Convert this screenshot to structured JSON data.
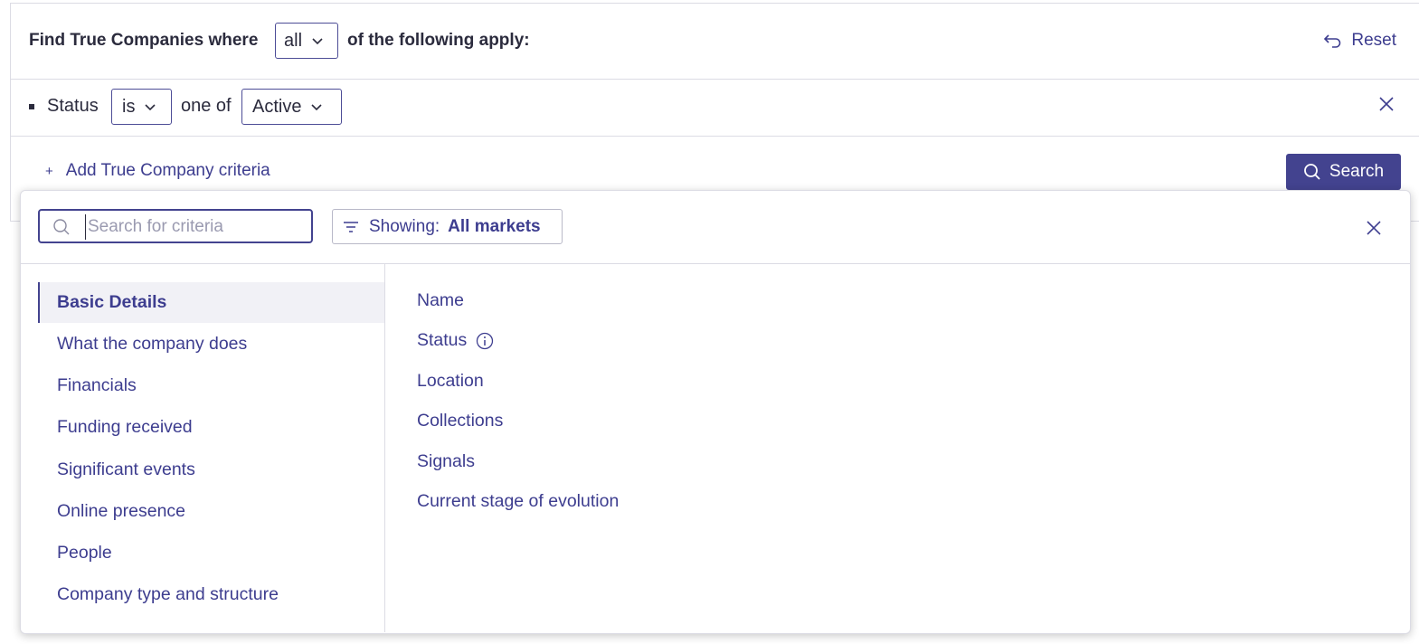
{
  "filter_bar": {
    "prefix": "Find True Companies where",
    "match_mode": "all",
    "suffix": "of the following apply:",
    "reset_label": "Reset"
  },
  "criteria_row": {
    "field": "Status",
    "operator": "is",
    "connector": "one of",
    "value": "Active"
  },
  "actions": {
    "add_label": "Add True Company criteria",
    "search_label": "Search"
  },
  "criteria_panel": {
    "search_placeholder": "Search for criteria",
    "search_value": "",
    "filter_prefix": "Showing:",
    "filter_value": "All markets",
    "categories": [
      {
        "label": "Basic Details",
        "active": true
      },
      {
        "label": "What the company does",
        "active": false
      },
      {
        "label": "Financials",
        "active": false
      },
      {
        "label": "Funding received",
        "active": false
      },
      {
        "label": "Significant events",
        "active": false
      },
      {
        "label": "Online presence",
        "active": false
      },
      {
        "label": "People",
        "active": false
      },
      {
        "label": "Company type and structure",
        "active": false
      }
    ],
    "items": [
      {
        "label": "Name",
        "info": false
      },
      {
        "label": "Status",
        "info": true
      },
      {
        "label": "Location",
        "info": false
      },
      {
        "label": "Collections",
        "info": false
      },
      {
        "label": "Signals",
        "info": false
      },
      {
        "label": "Current stage of evolution",
        "info": false
      }
    ]
  },
  "colors": {
    "accent": "#43438f",
    "link": "#3d3d8f",
    "text": "#2b2b3d",
    "border": "#dcdce4"
  },
  "icons": [
    "chevron-down-icon",
    "reset-icon",
    "close-icon",
    "plus-icon",
    "search-icon",
    "filter-icon",
    "info-icon"
  ]
}
